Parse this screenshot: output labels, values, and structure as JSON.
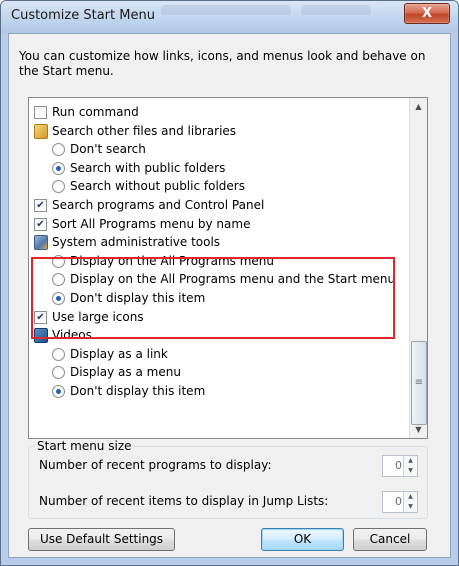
{
  "window": {
    "title": "Customize Start Menu",
    "close_label": "X"
  },
  "intro_text": "You can customize how links, icons, and menus look and behave on the Start menu.",
  "options": [
    {
      "type": "checkbox",
      "indent": 0,
      "checked": false,
      "label": "Run command"
    },
    {
      "type": "group",
      "indent": 0,
      "icon": "search-folder-icon",
      "label": "Search other files and libraries"
    },
    {
      "type": "radio",
      "indent": 1,
      "checked": false,
      "label": "Don't search"
    },
    {
      "type": "radio",
      "indent": 1,
      "checked": true,
      "label": "Search with public folders"
    },
    {
      "type": "radio",
      "indent": 1,
      "checked": false,
      "label": "Search without public folders"
    },
    {
      "type": "checkbox",
      "indent": 0,
      "checked": true,
      "label": "Search programs and Control Panel"
    },
    {
      "type": "checkbox",
      "indent": 0,
      "checked": true,
      "label": "Sort All Programs menu by name"
    },
    {
      "type": "group",
      "indent": 0,
      "icon": "admin-tools-icon",
      "label": "System administrative tools"
    },
    {
      "type": "radio",
      "indent": 1,
      "checked": false,
      "label": "Display on the All Programs menu"
    },
    {
      "type": "radio",
      "indent": 1,
      "checked": false,
      "label": "Display on the All Programs menu and the Start menu"
    },
    {
      "type": "radio",
      "indent": 1,
      "checked": true,
      "label": "Don't display this item"
    },
    {
      "type": "checkbox",
      "indent": 0,
      "checked": true,
      "label": "Use large icons"
    },
    {
      "type": "group",
      "indent": 0,
      "icon": "videos-icon",
      "label": "Videos"
    },
    {
      "type": "radio",
      "indent": 1,
      "checked": false,
      "label": "Display as a link"
    },
    {
      "type": "radio",
      "indent": 1,
      "checked": false,
      "label": "Display as a menu"
    },
    {
      "type": "radio",
      "indent": 1,
      "checked": true,
      "label": "Don't display this item"
    }
  ],
  "start_menu_size": {
    "legend": "Start menu size",
    "recent_programs_label": "Number of recent programs to display:",
    "recent_programs_value": "0",
    "recent_items_label": "Number of recent items to display in Jump Lists:",
    "recent_items_value": "0"
  },
  "buttons": {
    "default_settings": "Use Default Settings",
    "ok": "OK",
    "cancel": "Cancel"
  },
  "colors": {
    "highlight_border": "#e0252c",
    "radio_dot": "#1f5fb9"
  }
}
